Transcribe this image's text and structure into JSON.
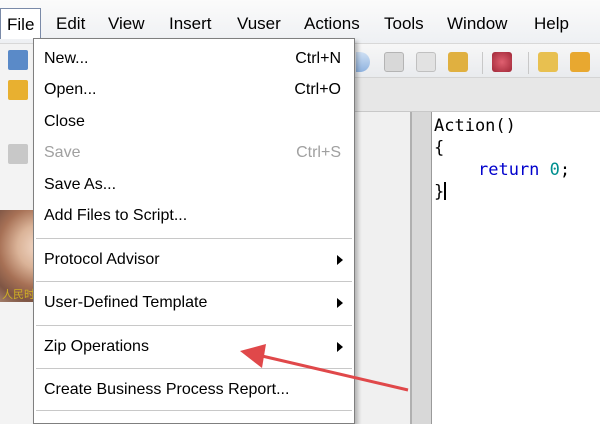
{
  "menubar": {
    "items": [
      "File",
      "Edit",
      "View",
      "Insert",
      "Vuser",
      "Actions",
      "Tools",
      "Window",
      "Help"
    ]
  },
  "file_menu": {
    "new": {
      "label": "New...",
      "shortcut": "Ctrl+N"
    },
    "open": {
      "label": "Open...",
      "shortcut": "Ctrl+O"
    },
    "close": {
      "label": "Close"
    },
    "save": {
      "label": "Save",
      "shortcut": "Ctrl+S",
      "enabled": false
    },
    "save_as": {
      "label": "Save As..."
    },
    "add_files": {
      "label": "Add Files to Script..."
    },
    "protocol_advisor": {
      "label": "Protocol Advisor"
    },
    "user_template": {
      "label": "User-Defined Template"
    },
    "zip_operations": {
      "label": "Zip Operations"
    },
    "business_report": {
      "label": "Create Business Process Report..."
    }
  },
  "editor": {
    "line1": "Action()",
    "line2": "{",
    "keyword": "return",
    "number": "0",
    "semicolon": ";",
    "line4": "}"
  },
  "thumbnail_text": "人民时报网",
  "colors": {
    "arrow": "#e0484a",
    "keyword": "#0000cc",
    "number": "#009090",
    "menu_border": "#7f7f7f"
  },
  "icons": {
    "arrow": "annotation-arrow",
    "submenu": "chevron-right-icon"
  }
}
